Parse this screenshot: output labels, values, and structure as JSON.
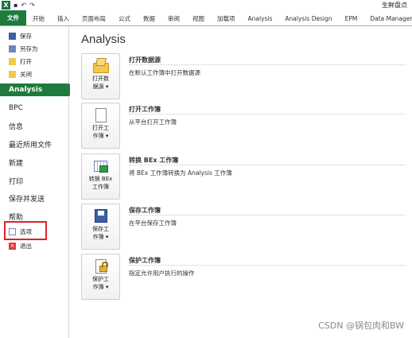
{
  "window": {
    "title": "生鲜盘点"
  },
  "qat": {
    "undo": "↶",
    "redo": "↷"
  },
  "ribbon": {
    "tabs": [
      "文件",
      "开始",
      "插入",
      "页面布局",
      "公式",
      "数据",
      "审阅",
      "视图",
      "加载项",
      "Analysis",
      "Analysis Design",
      "EPM",
      "Data Manager"
    ]
  },
  "nav": {
    "save": "保存",
    "save_as": "另存为",
    "open": "打开",
    "close": "关闭",
    "analysis": "Analysis",
    "bpc": "BPC",
    "info": "信息",
    "recent": "最近所用文件",
    "new": "新建",
    "print": "打印",
    "save_send": "保存并发送",
    "help": "帮助",
    "options": "选项",
    "exit": "退出"
  },
  "main": {
    "title": "Analysis",
    "actions": [
      {
        "button_line1": "打开数",
        "button_line2": "据源 ▾",
        "title": "打开数据源",
        "desc": "在默认工作簿中打开数据源",
        "icon": "open-data-source-icon"
      },
      {
        "button_line1": "打开工",
        "button_line2": "作簿 ▾",
        "title": "打开工作簿",
        "desc": "从平台打开工作簿",
        "icon": "open-workbook-icon"
      },
      {
        "button_line1": "转换 BEx",
        "button_line2": "工作簿",
        "title": "转换 BEx 工作簿",
        "desc": "将 BEx 工作簿转换为 Analysis 工作簿",
        "icon": "convert-bex-icon"
      },
      {
        "button_line1": "保存工",
        "button_line2": "作簿 ▾",
        "title": "保存工作簿",
        "desc": "在平台保存工作簿",
        "icon": "save-workbook-icon"
      },
      {
        "button_line1": "保护工",
        "button_line2": "作簿 ▾",
        "title": "保护工作簿",
        "desc": "指定允许用户执行的操作",
        "icon": "protect-workbook-icon"
      }
    ]
  },
  "watermark": "CSDN @锅包肉和BW",
  "colors": {
    "accent": "#1f7a3e",
    "highlight": "#e0212a"
  }
}
